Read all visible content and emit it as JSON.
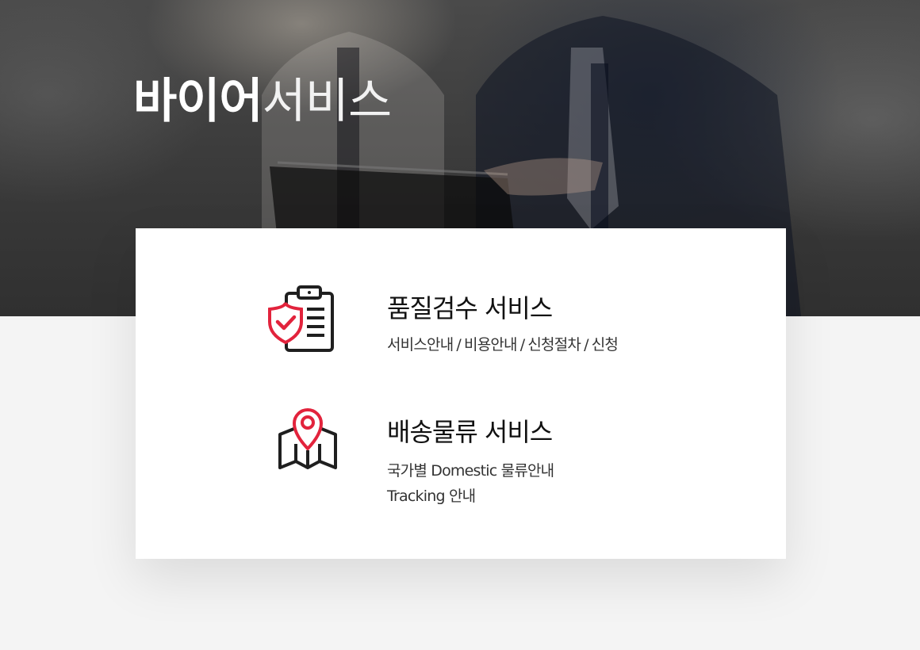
{
  "hero": {
    "title_bold": "바이어",
    "title_light": "서비스"
  },
  "colors": {
    "accent": "#e2233c",
    "icon_dark": "#1f1f1f"
  },
  "services": [
    {
      "title": "품질검수 서비스",
      "icon": "clipboard-shield-check-icon",
      "links": [
        "서비스안내",
        "비용안내",
        "신청절차",
        "신청"
      ],
      "separator": "/"
    },
    {
      "title": "배송물류 서비스",
      "icon": "map-location-pin-icon",
      "lines": [
        "국가별 Domestic 물류안내",
        "Tracking 안내"
      ]
    }
  ]
}
